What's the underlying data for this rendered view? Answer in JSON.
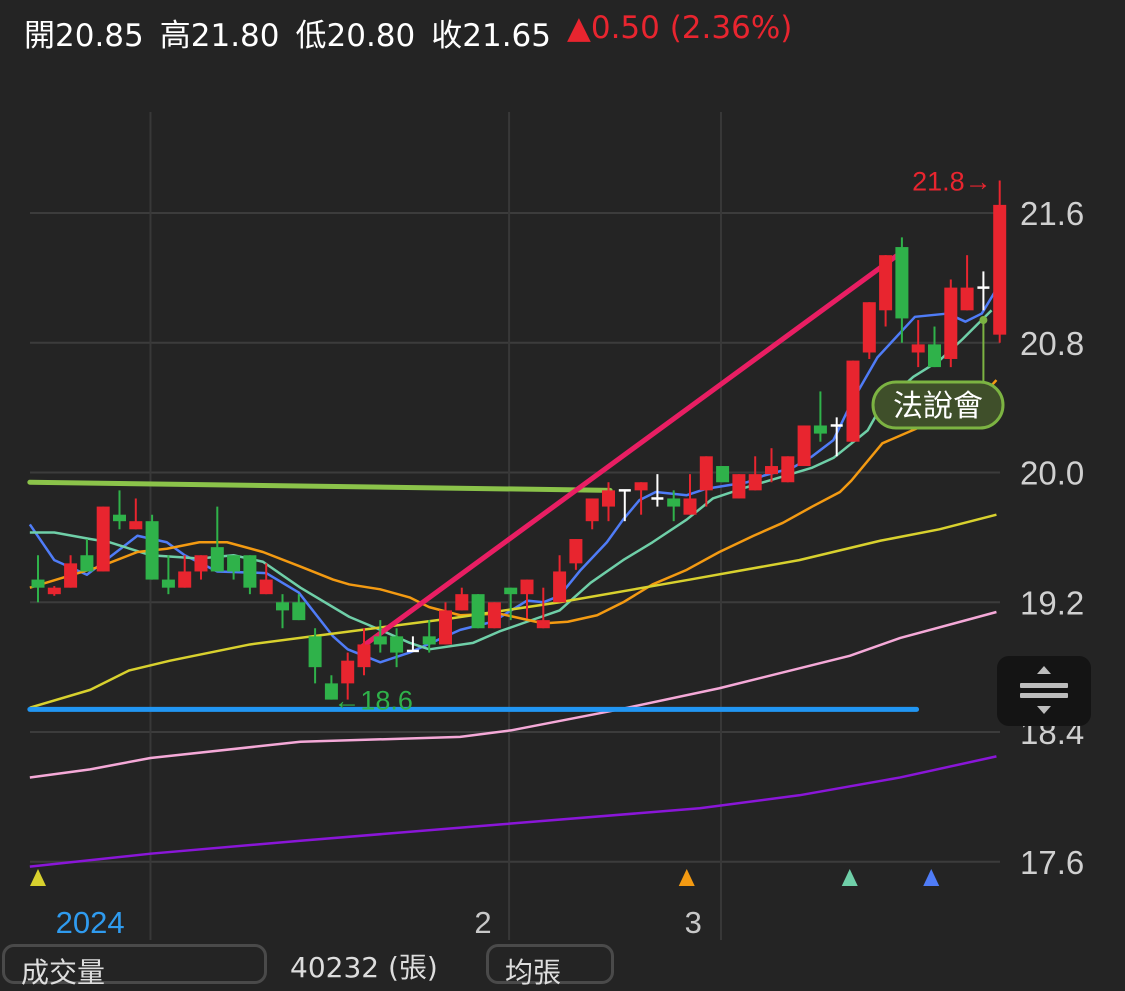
{
  "header": {
    "open_label": "開",
    "open": "20.85",
    "high_label": "高",
    "high": "21.80",
    "low_label": "低",
    "low": "20.80",
    "close_label": "收",
    "close": "21.65",
    "change": "▲0.50 (2.36%)"
  },
  "colors": {
    "up": "#e8252f",
    "down": "#2fb24a",
    "flat": "#ffffff",
    "bg": "#242424",
    "grid": "#3c3c3c"
  },
  "chart_data": {
    "type": "candlestick",
    "ylim": [
      17.5,
      21.9
    ],
    "yticks": [
      "21.6",
      "20.8",
      "20.0",
      "19.2",
      "18.4",
      "17.6"
    ],
    "ytick_values": [
      21.6,
      20.8,
      20.0,
      19.2,
      18.4,
      17.6
    ],
    "xticks": [
      {
        "label": "2024",
        "index": 3.2,
        "color": "#2f9bef"
      },
      {
        "label": "2",
        "index": 27.3,
        "color": "#c8c8c8"
      },
      {
        "label": "3",
        "index": 40.2,
        "color": "#c8c8c8"
      }
    ],
    "month_grid_index": [
      6.9,
      28.9,
      41.9
    ],
    "ohlc": [
      [
        19.34,
        19.49,
        19.2,
        19.29
      ],
      [
        19.25,
        19.3,
        19.24,
        19.29
      ],
      [
        19.29,
        19.49,
        19.29,
        19.44
      ],
      [
        19.49,
        19.59,
        19.39,
        19.39
      ],
      [
        19.39,
        19.79,
        19.39,
        19.79
      ],
      [
        19.74,
        19.89,
        19.65,
        19.7
      ],
      [
        19.65,
        19.84,
        19.65,
        19.7
      ],
      [
        19.7,
        19.74,
        19.34,
        19.34
      ],
      [
        19.34,
        19.49,
        19.25,
        19.29
      ],
      [
        19.29,
        19.49,
        19.29,
        19.39
      ],
      [
        19.39,
        19.49,
        19.34,
        19.49
      ],
      [
        19.54,
        19.79,
        19.39,
        19.39
      ],
      [
        19.49,
        19.49,
        19.34,
        19.39
      ],
      [
        19.49,
        19.49,
        19.25,
        19.29
      ],
      [
        19.25,
        19.44,
        19.25,
        19.34
      ],
      [
        19.2,
        19.25,
        19.04,
        19.15
      ],
      [
        19.2,
        19.25,
        19.09,
        19.09
      ],
      [
        18.99,
        19.04,
        18.7,
        18.8
      ],
      [
        18.7,
        18.75,
        18.6,
        18.6
      ],
      [
        18.7,
        18.89,
        18.6,
        18.84
      ],
      [
        18.8,
        19.04,
        18.75,
        18.94
      ],
      [
        18.99,
        19.09,
        18.89,
        18.94
      ],
      [
        18.99,
        19.04,
        18.8,
        18.89
      ],
      [
        18.9,
        18.99,
        18.9,
        18.9
      ],
      [
        18.99,
        19.09,
        18.89,
        18.94
      ],
      [
        18.94,
        19.2,
        18.94,
        19.15
      ],
      [
        19.15,
        19.29,
        19.15,
        19.25
      ],
      [
        19.25,
        19.25,
        19.04,
        19.04
      ],
      [
        19.04,
        19.2,
        19.04,
        19.2
      ],
      [
        19.29,
        19.29,
        19.09,
        19.25
      ],
      [
        19.25,
        19.34,
        19.1,
        19.34
      ],
      [
        19.04,
        19.29,
        19.04,
        19.09
      ],
      [
        19.2,
        19.49,
        19.2,
        19.39
      ],
      [
        19.44,
        19.59,
        19.4,
        19.59
      ],
      [
        19.7,
        19.84,
        19.65,
        19.84
      ],
      [
        19.79,
        19.94,
        19.7,
        19.89
      ],
      [
        19.89,
        19.89,
        19.7,
        19.89
      ],
      [
        19.89,
        19.94,
        19.74,
        19.94
      ],
      [
        19.84,
        19.99,
        19.79,
        19.84
      ],
      [
        19.84,
        19.89,
        19.7,
        19.79
      ],
      [
        19.74,
        19.99,
        19.74,
        19.84
      ],
      [
        19.89,
        20.1,
        19.79,
        20.1
      ],
      [
        20.04,
        20.04,
        19.94,
        19.94
      ],
      [
        19.84,
        19.99,
        19.84,
        19.99
      ],
      [
        19.89,
        20.1,
        19.89,
        19.99
      ],
      [
        19.99,
        20.15,
        19.94,
        20.04
      ],
      [
        19.94,
        20.1,
        19.94,
        20.1
      ],
      [
        20.04,
        20.29,
        20.04,
        20.29
      ],
      [
        20.29,
        20.5,
        20.19,
        20.24
      ],
      [
        20.29,
        20.34,
        20.1,
        20.29
      ],
      [
        20.19,
        20.69,
        20.19,
        20.69
      ],
      [
        20.74,
        21.05,
        20.7,
        21.05
      ],
      [
        21.0,
        21.34,
        20.9,
        21.34
      ],
      [
        21.39,
        21.45,
        20.8,
        20.95
      ],
      [
        20.74,
        20.94,
        20.65,
        20.79
      ],
      [
        20.79,
        20.9,
        20.65,
        20.65
      ],
      [
        20.7,
        21.19,
        20.65,
        21.14
      ],
      [
        21.0,
        21.34,
        21.0,
        21.14
      ],
      [
        21.14,
        21.24,
        21.0,
        21.14
      ],
      [
        20.85,
        21.8,
        20.8,
        21.65
      ]
    ],
    "moving_averages": [
      {
        "name": "MA5",
        "color": "#4f7cf7",
        "points": [
          [
            -0.5,
            19.68
          ],
          [
            1,
            19.46
          ],
          [
            3,
            19.37
          ],
          [
            6.1,
            19.61
          ],
          [
            7.9,
            19.57
          ],
          [
            9,
            19.49
          ],
          [
            11,
            19.39
          ],
          [
            14,
            19.38
          ],
          [
            16,
            19.26
          ],
          [
            18.1,
            18.99
          ],
          [
            19,
            18.91
          ],
          [
            21,
            18.83
          ],
          [
            22.8,
            18.89
          ],
          [
            25.9,
            19.03
          ],
          [
            27.9,
            19.08
          ],
          [
            30,
            19.21
          ],
          [
            31,
            19.2
          ],
          [
            32,
            19.24
          ],
          [
            33.3,
            19.4
          ],
          [
            34.9,
            19.57
          ],
          [
            35.9,
            19.71
          ],
          [
            36.9,
            19.83
          ],
          [
            37.9,
            19.88
          ],
          [
            39.8,
            19.86
          ],
          [
            41,
            19.9
          ],
          [
            43.5,
            19.94
          ],
          [
            44.5,
            19.98
          ],
          [
            46.3,
            20.03
          ],
          [
            47.5,
            20.1
          ],
          [
            48.8,
            20.2
          ],
          [
            49.9,
            20.43
          ],
          [
            51.5,
            20.71
          ],
          [
            53.8,
            20.96
          ],
          [
            55.8,
            20.98
          ],
          [
            56.9,
            20.93
          ],
          [
            57.9,
            20.98
          ],
          [
            58.8,
            21.13
          ]
        ]
      },
      {
        "name": "MA10",
        "color": "#6fcfa8",
        "points": [
          [
            -0.5,
            19.63
          ],
          [
            1,
            19.63
          ],
          [
            3.2,
            19.59
          ],
          [
            4.4,
            19.57
          ],
          [
            6.9,
            19.49
          ],
          [
            9.9,
            19.47
          ],
          [
            12,
            19.49
          ],
          [
            13.8,
            19.45
          ],
          [
            16.1,
            19.29
          ],
          [
            19.1,
            19.11
          ],
          [
            21,
            19.03
          ],
          [
            22.8,
            18.95
          ],
          [
            24,
            18.91
          ],
          [
            26.7,
            18.95
          ],
          [
            28.3,
            19.02
          ],
          [
            30,
            19.08
          ],
          [
            32,
            19.15
          ],
          [
            33.9,
            19.32
          ],
          [
            35.9,
            19.46
          ],
          [
            37.7,
            19.57
          ],
          [
            39.8,
            19.71
          ],
          [
            41.4,
            19.84
          ],
          [
            43.5,
            19.91
          ],
          [
            45.5,
            19.97
          ],
          [
            47.5,
            20.03
          ],
          [
            48.8,
            20.09
          ],
          [
            50.9,
            20.26
          ],
          [
            51.8,
            20.42
          ],
          [
            53.7,
            20.59
          ],
          [
            55.3,
            20.69
          ],
          [
            56.7,
            20.82
          ],
          [
            57.8,
            20.93
          ],
          [
            58.5,
            21.0
          ]
        ]
      },
      {
        "name": "MA20",
        "color": "#f39a12",
        "points": [
          [
            -0.5,
            19.29
          ],
          [
            1.8,
            19.36
          ],
          [
            3.8,
            19.42
          ],
          [
            6.1,
            19.51
          ],
          [
            7.9,
            19.53
          ],
          [
            9.9,
            19.57
          ],
          [
            11.6,
            19.57
          ],
          [
            13.8,
            19.51
          ],
          [
            16.1,
            19.42
          ],
          [
            18.1,
            19.34
          ],
          [
            19.1,
            19.31
          ],
          [
            21,
            19.28
          ],
          [
            22.8,
            19.23
          ],
          [
            24,
            19.17
          ],
          [
            25.9,
            19.12
          ],
          [
            28.3,
            19.13
          ],
          [
            31,
            19.07
          ],
          [
            32.5,
            19.08
          ],
          [
            34.3,
            19.12
          ],
          [
            35.9,
            19.2
          ],
          [
            37.7,
            19.31
          ],
          [
            39.8,
            19.4
          ],
          [
            41.8,
            19.51
          ],
          [
            43.9,
            19.61
          ],
          [
            45.7,
            19.69
          ],
          [
            47.5,
            19.79
          ],
          [
            49.2,
            19.88
          ],
          [
            49.9,
            19.95
          ],
          [
            51.8,
            20.18
          ],
          [
            54.1,
            20.28
          ],
          [
            56.1,
            20.35
          ],
          [
            57.8,
            20.46
          ],
          [
            58.8,
            20.57
          ]
        ]
      },
      {
        "name": "MA60",
        "color": "#d8d12e",
        "points": [
          [
            -0.5,
            18.55
          ],
          [
            3.2,
            18.66
          ],
          [
            5.6,
            18.78
          ],
          [
            8.1,
            18.84
          ],
          [
            13,
            18.94
          ],
          [
            19.1,
            19.02
          ],
          [
            25.3,
            19.1
          ],
          [
            32,
            19.2
          ],
          [
            40,
            19.34
          ],
          [
            46.7,
            19.46
          ],
          [
            51.7,
            19.58
          ],
          [
            55.3,
            19.65
          ],
          [
            58.8,
            19.74
          ]
        ]
      },
      {
        "name": "MA120",
        "color": "#f5a9d8",
        "points": [
          [
            -0.5,
            18.12
          ],
          [
            3.2,
            18.17
          ],
          [
            6.9,
            18.24
          ],
          [
            16.1,
            18.34
          ],
          [
            25.9,
            18.37
          ],
          [
            29,
            18.41
          ],
          [
            35.7,
            18.54
          ],
          [
            41.8,
            18.67
          ],
          [
            49.8,
            18.87
          ],
          [
            52.9,
            18.98
          ],
          [
            58.8,
            19.14
          ]
        ]
      },
      {
        "name": "MA240",
        "color": "#8a16d8",
        "points": [
          [
            -0.5,
            17.57
          ],
          [
            6.9,
            17.65
          ],
          [
            16.1,
            17.73
          ],
          [
            28.3,
            17.83
          ],
          [
            40.6,
            17.93
          ],
          [
            46.7,
            18.01
          ],
          [
            52.9,
            18.12
          ],
          [
            58.8,
            18.25
          ]
        ]
      }
    ],
    "drawings": [
      {
        "name": "resistance-line",
        "color": "#8bc34a",
        "from": [
          -0.5,
          19.94
        ],
        "to": [
          35.1,
          19.89
        ]
      },
      {
        "name": "support-line",
        "color": "#2196f3",
        "from": [
          -0.5,
          18.54
        ],
        "to": [
          53.9,
          18.54
        ]
      },
      {
        "name": "trend-line",
        "color": "#e91e63",
        "from": [
          19.8,
          18.92
        ],
        "to": [
          53.0,
          21.36
        ]
      }
    ],
    "annotations": {
      "high": {
        "text": "21.8→",
        "index": 59,
        "value": 21.8,
        "color": "#e8252f"
      },
      "low": {
        "text": "←18.6",
        "index": 18,
        "value": 18.6,
        "color": "#2fb24a"
      },
      "event": {
        "text": "法說會",
        "index": 58,
        "value": 20.94
      }
    },
    "signal_markers": [
      {
        "index": 0,
        "color": "#d8d12e"
      },
      {
        "index": 39.8,
        "color": "#f39a12"
      },
      {
        "index": 49.8,
        "color": "#6fcfa8"
      },
      {
        "index": 54.8,
        "color": "#4f7cf7"
      }
    ]
  },
  "bottom": {
    "tab1": "成交量",
    "volume": "40232 (張)",
    "tab2": "均張"
  }
}
